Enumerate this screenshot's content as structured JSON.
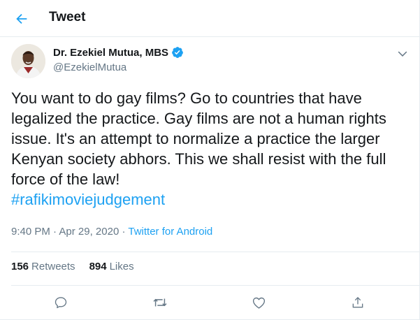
{
  "header": {
    "title": "Tweet"
  },
  "tweet": {
    "author_name": "Dr. Ezekiel Mutua, MBS",
    "handle": "@EzekielMutua",
    "text": "You want to do gay films? Go to countries that have legalized the practice. Gay films are not a human rights issue. It's an attempt to normalize a practice the larger Kenyan society abhors. This we shall resist with the full force of the law!",
    "hashtag": "#rafikimoviejudgement",
    "time": "9:40 PM",
    "date": "Apr 29, 2020",
    "separator": "·",
    "source": "Twitter for Android"
  },
  "stats": {
    "retweets_count": "156",
    "retweets_label": "Retweets",
    "likes_count": "894",
    "likes_label": "Likes"
  },
  "colors": {
    "accent": "#1da1f2",
    "secondary_text": "#657786",
    "border": "#e6ecf0"
  },
  "icons": {
    "back": "arrow-left-icon",
    "verified": "verified-badge-icon",
    "more": "chevron-down-icon",
    "reply": "reply-icon",
    "retweet": "retweet-icon",
    "like": "heart-icon",
    "share": "share-icon"
  }
}
